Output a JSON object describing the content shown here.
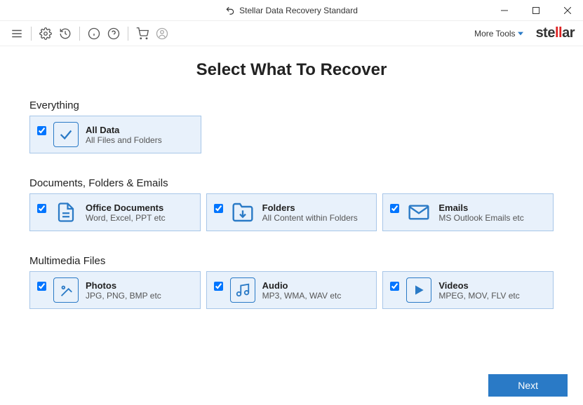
{
  "window": {
    "title": "Stellar Data Recovery Standard"
  },
  "toolbar": {
    "more_tools": "More Tools",
    "brand_prefix": "ste",
    "brand_flip": "ll",
    "brand_suffix": "ar"
  },
  "page": {
    "title": "Select What To Recover"
  },
  "sections": {
    "everything": {
      "heading": "Everything",
      "card": {
        "title": "All Data",
        "sub": "All Files and Folders"
      }
    },
    "documents": {
      "heading": "Documents, Folders & Emails",
      "cards": [
        {
          "title": "Office Documents",
          "sub": "Word, Excel, PPT etc"
        },
        {
          "title": "Folders",
          "sub": "All Content within Folders"
        },
        {
          "title": "Emails",
          "sub": "MS Outlook Emails etc"
        }
      ]
    },
    "multimedia": {
      "heading": "Multimedia Files",
      "cards": [
        {
          "title": "Photos",
          "sub": "JPG, PNG, BMP etc"
        },
        {
          "title": "Audio",
          "sub": "MP3, WMA, WAV etc"
        },
        {
          "title": "Videos",
          "sub": "MPEG, MOV, FLV etc"
        }
      ]
    }
  },
  "footer": {
    "next": "Next"
  }
}
